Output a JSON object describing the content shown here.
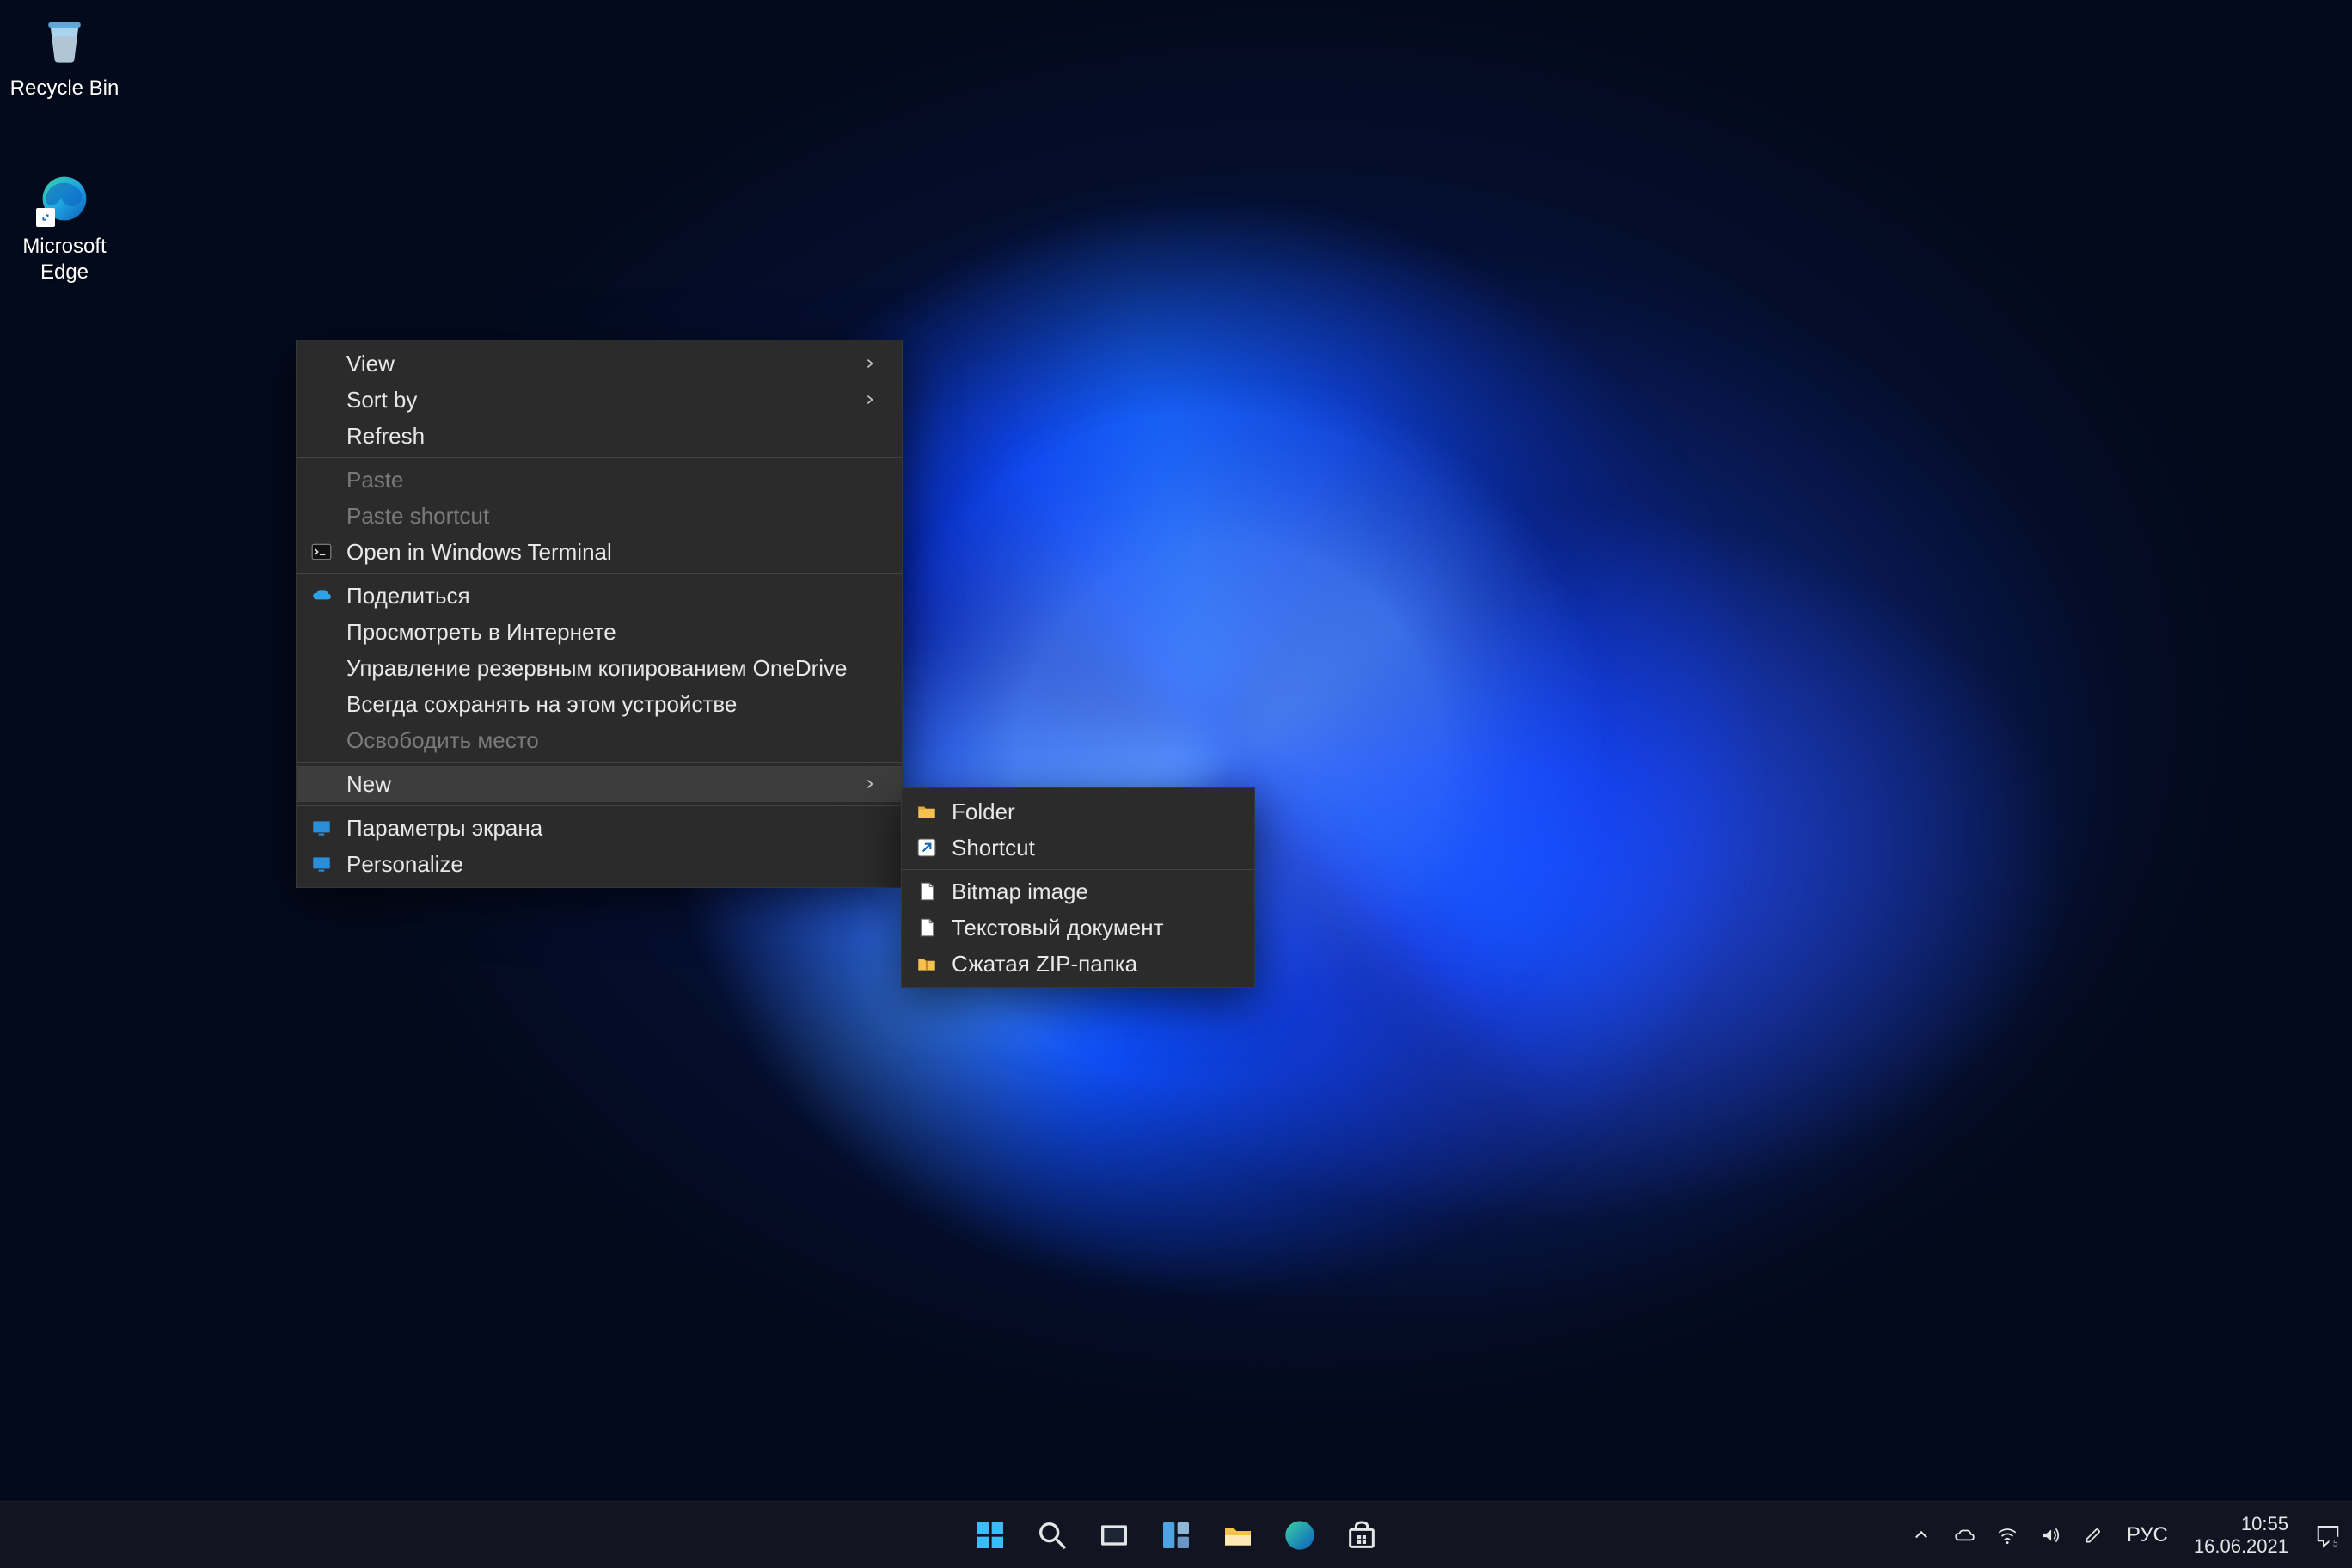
{
  "desktop": {
    "icons": [
      {
        "name": "recycle-bin",
        "label": "Recycle Bin"
      },
      {
        "name": "microsoft-edge",
        "label": "Microsoft\nEdge"
      }
    ]
  },
  "context_menu": {
    "groups": [
      [
        {
          "id": "view",
          "label": "View",
          "submenu": true
        },
        {
          "id": "sort",
          "label": "Sort by",
          "submenu": true
        },
        {
          "id": "refresh",
          "label": "Refresh"
        }
      ],
      [
        {
          "id": "paste",
          "label": "Paste",
          "disabled": true
        },
        {
          "id": "paste-shortcut",
          "label": "Paste shortcut",
          "disabled": true
        },
        {
          "id": "open-terminal",
          "label": "Open in Windows Terminal",
          "icon": "terminal"
        }
      ],
      [
        {
          "id": "share",
          "label": "Поделиться",
          "icon": "onedrive"
        },
        {
          "id": "view-online",
          "label": "Просмотреть в Интернете"
        },
        {
          "id": "manage-backup",
          "label": "Управление резервным копированием OneDrive"
        },
        {
          "id": "always-keep",
          "label": "Всегда сохранять на этом устройстве"
        },
        {
          "id": "free-up-space",
          "label": "Освободить место",
          "disabled": true
        }
      ],
      [
        {
          "id": "new",
          "label": "New",
          "submenu": true,
          "hovered": true
        }
      ],
      [
        {
          "id": "display-settings",
          "label": "Параметры экрана",
          "icon": "display"
        },
        {
          "id": "personalize",
          "label": "Personalize",
          "icon": "display"
        }
      ]
    ],
    "new_submenu": {
      "groups": [
        [
          {
            "id": "new-folder",
            "label": "Folder",
            "icon": "folder"
          },
          {
            "id": "new-shortcut",
            "label": "Shortcut",
            "icon": "shortcut"
          }
        ],
        [
          {
            "id": "new-bitmap",
            "label": "Bitmap image",
            "icon": "file"
          },
          {
            "id": "new-text",
            "label": "Текстовый документ",
            "icon": "file"
          },
          {
            "id": "new-zip",
            "label": "Сжатая ZIP-папка",
            "icon": "zip-folder"
          }
        ]
      ]
    }
  },
  "taskbar": {
    "center": [
      {
        "id": "start",
        "name": "start-button",
        "icon": "start"
      },
      {
        "id": "search",
        "name": "search-button",
        "icon": "search"
      },
      {
        "id": "taskview",
        "name": "task-view-button",
        "icon": "taskview"
      },
      {
        "id": "widgets",
        "name": "widgets-button",
        "icon": "widgets"
      },
      {
        "id": "explorer",
        "name": "file-explorer",
        "icon": "explorer"
      },
      {
        "id": "edge",
        "name": "microsoft-edge",
        "icon": "edge"
      },
      {
        "id": "store",
        "name": "microsoft-store",
        "icon": "store"
      }
    ],
    "tray": {
      "overflow": true,
      "items": [
        {
          "id": "onedrive",
          "name": "onedrive-tray-icon",
          "icon": "cloud"
        },
        {
          "id": "network",
          "name": "network-tray-icon",
          "icon": "wifi"
        },
        {
          "id": "volume",
          "name": "volume-tray-icon",
          "icon": "volume"
        },
        {
          "id": "pen",
          "name": "pen-tray-icon",
          "icon": "pen"
        }
      ],
      "language": "РУС",
      "time": "10:55",
      "date": "16.06.2021",
      "notification_count": "5"
    }
  }
}
